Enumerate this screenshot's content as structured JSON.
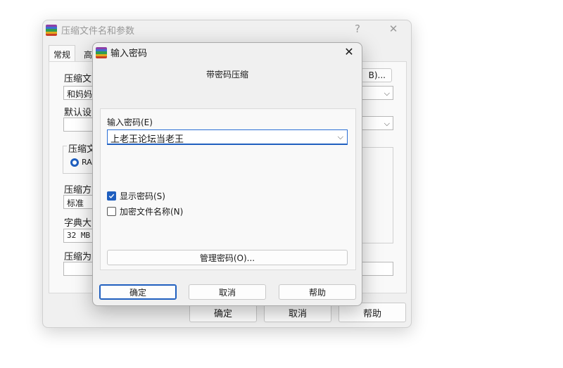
{
  "main_window": {
    "title": "压缩文件名和参数",
    "help_icon": "?",
    "close_icon": "✕",
    "tabs": [
      {
        "label": "常规"
      },
      {
        "label": "高"
      }
    ],
    "labels": {
      "archive_name": "压缩文",
      "default_settings": "默认设",
      "format_group": "压缩文",
      "method": "压缩方",
      "dictionary": "字典大",
      "compress_to": "压缩为"
    },
    "values": {
      "archive_name": "和妈妈",
      "format_radio": "RA",
      "method": "标准",
      "dictionary": "32 MB",
      "browse_button": "B)..."
    },
    "buttons": {
      "ok": "确定",
      "cancel": "取消",
      "help": "帮助"
    }
  },
  "dialog": {
    "title": "输入密码",
    "close_icon": "✕",
    "heading": "带密码压缩",
    "password_label": "输入密码(E)",
    "password_value": "上老王论坛当老王",
    "show_password": {
      "label": "显示密码(S)",
      "checked": true
    },
    "encrypt_names": {
      "label": "加密文件名称(N)",
      "checked": false
    },
    "manage_button": "管理密码(O)...",
    "buttons": {
      "ok": "确定",
      "cancel": "取消",
      "help": "帮助"
    }
  },
  "colors": {
    "accent": "#1f5fbf"
  }
}
